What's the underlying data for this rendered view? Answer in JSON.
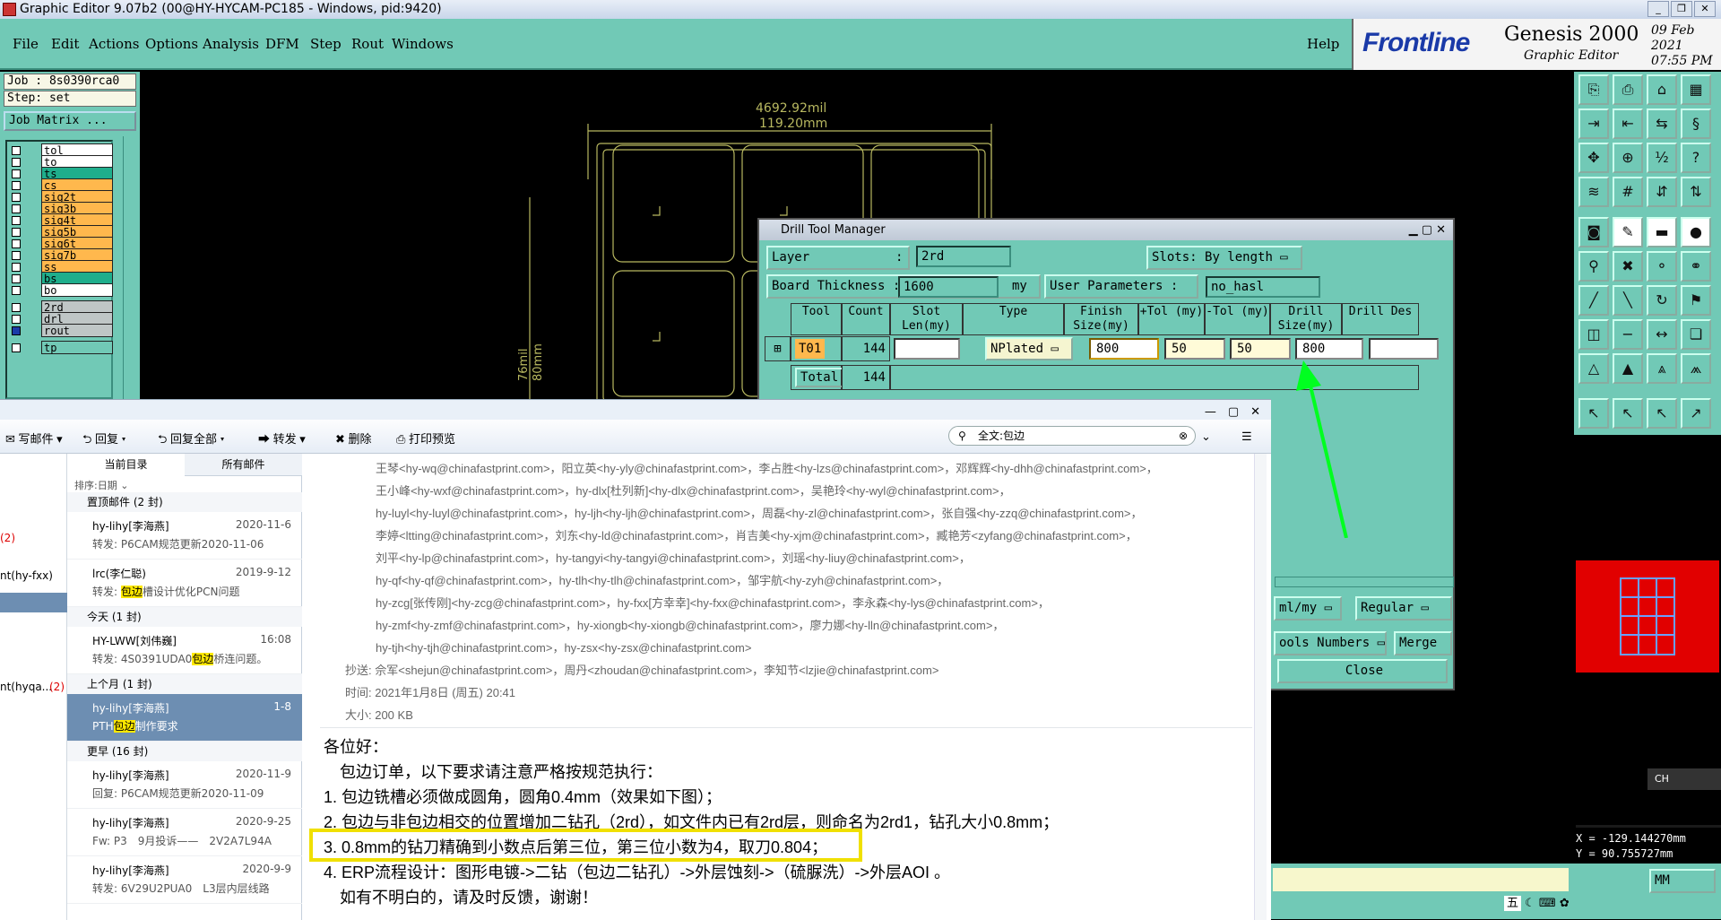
{
  "window": {
    "title": "Graphic Editor 9.07b2 (00@HY-HYCAM-PC185 - Windows, pid:9420)"
  },
  "menu": [
    "File",
    "Edit",
    "Actions",
    "Options",
    "Analysis",
    "DFM",
    "Step",
    "Rout",
    "Windows"
  ],
  "help": "Help",
  "brand": {
    "logo": "Frontline",
    "product": "Genesis 2000",
    "sub": "Graphic Editor",
    "date": "09 Feb 2021",
    "time": "07:55 PM"
  },
  "job": {
    "job": "Job : 8s0390rca0",
    "step": "Step: set",
    "matrix": "Job Matrix ..."
  },
  "layers": [
    "tol",
    "to",
    "ts",
    "cs",
    "sig2t",
    "sig3b",
    "sig4t",
    "sig5b",
    "sig6t",
    "sig7b",
    "ss",
    "bs",
    "bo",
    "2rd",
    "drl",
    "rout",
    "tp"
  ],
  "canvas": {
    "dim1": "4692.92mil",
    "dim2": "119.20mm",
    "vdim1": "76mil",
    "vdim2": "80mm"
  },
  "dtm": {
    "title": "Drill Tool Manager",
    "layer_label": "Layer",
    ":": ":",
    "layer_value": "2rd",
    "slots_label": "Slots:",
    "slots_value": "By length",
    "thick_label": "Board Thickness :",
    "thick_value": "1600",
    "thick_unit": "my",
    "userparams_label": "User Parameters :",
    "userparams_value": "no_hasl",
    "headers": [
      "Tool",
      "Count",
      "Slot Len(my)",
      "Type",
      "Finish Size(my)",
      "+Tol (my)",
      "-Tol (my)",
      "Drill Size(my)",
      "Drill Des"
    ],
    "row": {
      "tool": "T01",
      "count": "144",
      "type": "NPlated",
      "finish": "800",
      "ptol": "50",
      "mtol": "50",
      "drill": "800"
    },
    "total": {
      "label": "Total",
      "count": "144"
    },
    "units": "ml/my",
    "regular": "Regular",
    "toolsnum": "ools Numbers",
    "merge": "Merge",
    "close": "Close"
  },
  "coords": {
    "x": "X = -129.144270mm",
    "y": "Y = 90.755727mm"
  },
  "unit_sel": "MM",
  "ime": "CH",
  "mail": {
    "toolbar": [
      "写邮件",
      "回复",
      "回复全部",
      "转发",
      "删除",
      "打印预览"
    ],
    "search": "全文:包边",
    "nav": [
      "(2)",
      "nt(hy-fxx)",
      "nt(hyqa...",
      "(2)"
    ],
    "tabs": [
      "当前目录",
      "所有邮件"
    ],
    "sort": "排序:日期",
    "groups": [
      "置顶邮件 (2 封)",
      "今天 (1 封)",
      "上个月 (1 封)",
      "更早 (16 封)"
    ],
    "items": [
      {
        "from": "hy-lihy[李海燕]",
        "date": "2020-11-6",
        "subj": "转发: P6CAM规范更新2020-11-06"
      },
      {
        "from": "lrc(李仁聪)",
        "date": "2019-9-12",
        "subj": "转发: 包边槽设计优化PCN问题"
      },
      {
        "from": "HY-LWW[刘伟巍]",
        "date": "16:08",
        "subj": "转发: 4S0391UDA0包边桥连问题。"
      },
      {
        "from": "hy-lihy[李海燕]",
        "date": "1-8",
        "subj": "PTH包边制作要求"
      },
      {
        "from": "hy-lihy[李海燕]",
        "date": "2020-11-9",
        "subj": "回复: P6CAM规范更新2020-11-09"
      },
      {
        "from": "hy-lihy[李海燕]",
        "date": "2020-9-25",
        "subj": "Fw: P3　9月投诉——　2V2A7L94A"
      },
      {
        "from": "hy-lihy[李海燕]",
        "date": "2020-9-9",
        "subj": "转发: 6V29U2PUA0　L3层内层线路"
      }
    ],
    "recips": [
      "王琴<hy-wq@chinafastprint.com>，阳立英<hy-yly@chinafastprint.com>，李占胜<hy-lzs@chinafastprint.com>，邓辉辉<hy-dhh@chinafastprint.com>，",
      "王小峰<hy-wxf@chinafastprint.com>，hy-dlx[杜列新]<hy-dlx@chinafastprint.com>，吴艳玲<hy-wyl@chinafastprint.com>，",
      "hy-luyl<hy-luyl@chinafastprint.com>，hy-ljh<hy-ljh@chinafastprint.com>，周磊<hy-zl@chinafastprint.com>，张自强<hy-zzq@chinafastprint.com>，",
      "李婷<ltting@chinafastprint.com>，刘东<hy-ld@chinafastprint.com>，肖吉美<hy-xjm@chinafastprint.com>，臧艳芳<zyfang@chinafastprint.com>，",
      "刘平<hy-lp@chinafastprint.com>，hy-tangyi<hy-tangyi@chinafastprint.com>，刘瑶<hy-liuy@chinafastprint.com>，",
      "hy-qf<hy-qf@chinafastprint.com>，hy-tlh<hy-tlh@chinafastprint.com>，邹宇航<hy-zyh@chinafastprint.com>，",
      "hy-zcg[张传刚]<hy-zcg@chinafastprint.com>，hy-fxx[方幸幸]<hy-fxx@chinafastprint.com>，李永森<hy-lys@chinafastprint.com>，",
      "hy-zmf<hy-zmf@chinafastprint.com>，hy-xiongb<hy-xiongb@chinafastprint.com>，廖力娜<hy-lln@chinafastprint.com>，",
      "hy-tjh<hy-tjh@chinafastprint.com>，hy-zsx<hy-zsx@chinafastprint.com>"
    ],
    "cc": "抄送: 佘军<shejun@chinafastprint.com>，周丹<zhoudan@chinafastprint.com>，李知节<lzjie@chinafastprint.com>",
    "time": "时间: 2021年1月8日 (周五) 20:41",
    "size": "大小: 200 KB",
    "body": [
      "各位好：",
      "包边订单，以下要求请注意严格按规范执行：",
      "1. 包边铣槽必须做成圆角，圆角0.4mm（效果如下图）；",
      "2. 包边与非包边相交的位置增加二钻孔（2rd），如文件内已有2rd层，则命名为2rd1，钻孔大小0.8mm；",
      "3. 0.8mm的钻刀精确到小数点后第三位，第三位小数为4，取刀0.804；",
      "4. ERP流程设计：图形电镀->二钻（包边二钻孔）->外层蚀刻->（硫脲洗）->外层AOI 。",
      "如有不明白的，请及时反馈，谢谢！"
    ],
    "ime_bar": "五"
  }
}
